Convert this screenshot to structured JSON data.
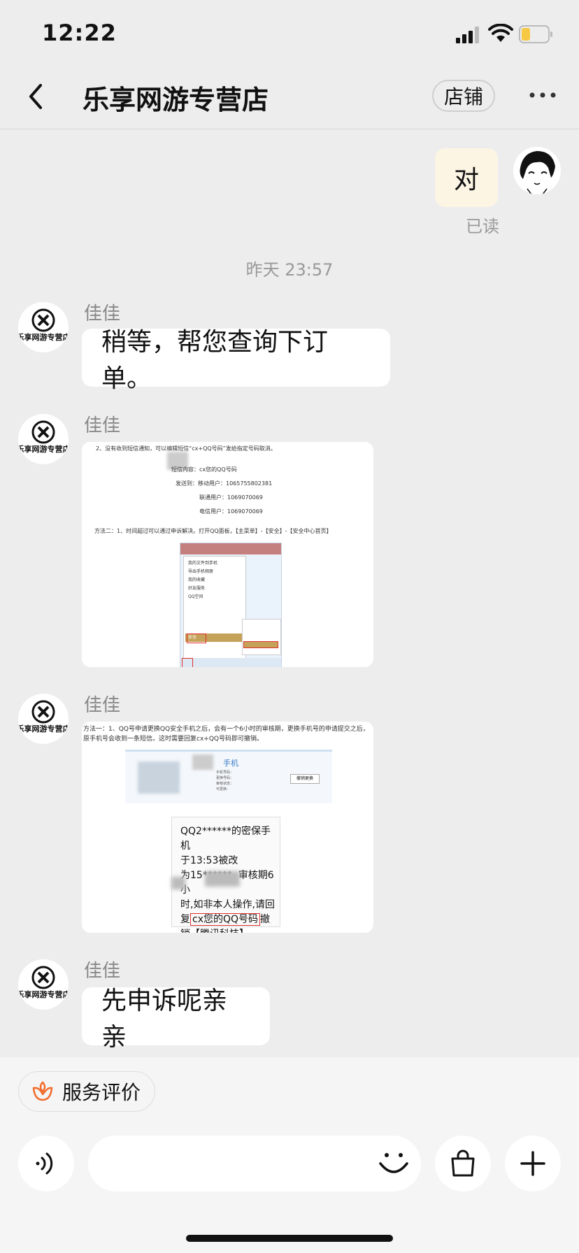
{
  "status": {
    "time": "12:22"
  },
  "nav": {
    "title": "乐享网游专营店",
    "shop_label": "店铺"
  },
  "conversation": {
    "my_message": "对",
    "read_status": "已读",
    "timestamp": "昨天 23:57",
    "messages": [
      {
        "sender": "佳佳",
        "text": "稍等，帮您查询下订单。"
      },
      {
        "sender": "佳佳",
        "image": "screenshot-instructions-1"
      },
      {
        "sender": "佳佳",
        "image": "screenshot-instructions-2"
      },
      {
        "sender": "佳佳",
        "text": "先申诉呢亲亲"
      }
    ]
  },
  "image1": {
    "line1": "2、没有收到短信通知，可以编辑短信“cx+QQ号码”发给指定号码取消。",
    "sms_content": "短信内容：cx您的QQ号码",
    "send_to": "发送到：移动用户：1065755802381",
    "unicom": "联通用户：1069070069",
    "telecom": "电信用户：1069070069",
    "method": "方法二：1、时间超过可以通过申诉解决。打开QQ面板，【主菜单】-【安全】-【安全中心首页】",
    "menu_items": [
      "我的文件到手机",
      "导出手机相册",
      "我的收藏",
      "好友服务",
      "QQ空间",
      "安全"
    ]
  },
  "image2": {
    "method": "方法一：1、QQ号申请更换QQ安全手机之后，会有一个6小时的审核期，更换手机号的申请提交之后，原手机号会收到一条短信。这时需要回复cx+QQ号码即可撤销。",
    "phone_title": "手机",
    "cancel_btn": "撤销更换",
    "sms_text_1": "QQ2******的密保手机",
    "sms_text_2": "于13:53被改",
    "sms_text_3": "为15******, 审核期6小",
    "sms_text_4": "时,如非本人操作,请回",
    "sms_text_5": "复",
    "sms_highlight": "cx您的QQ号码",
    "sms_text_6": "撤",
    "sms_text_7": "销【腾讯科技】"
  },
  "bottom": {
    "rate_label": "服务评价"
  },
  "shop_logo_text": "乐享网游专营店",
  "colors": {
    "my_bubble": "#fcf5e4",
    "rate_icon": "#f26c2b",
    "highlight": "#e0302b"
  }
}
